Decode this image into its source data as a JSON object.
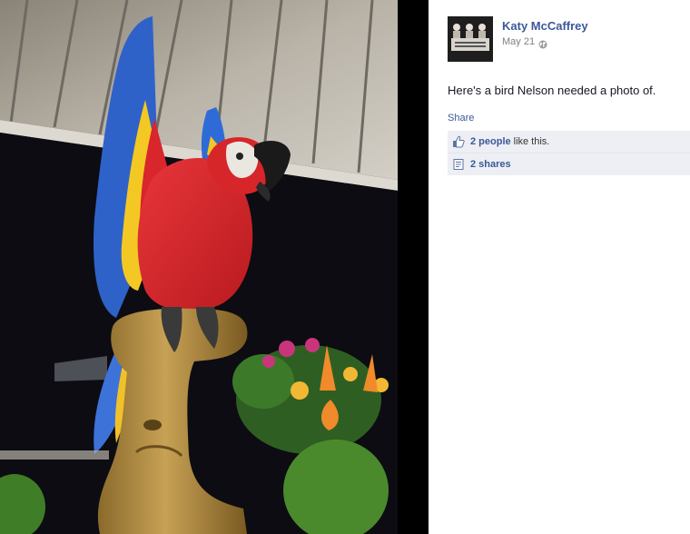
{
  "post": {
    "author_name": "Katy McCaffrey",
    "date": "May 21",
    "text": "Here's a bird Nelson needed a photo of.",
    "share_label": "Share"
  },
  "ufi": {
    "likes_link": "2 people",
    "likes_suffix": "like this.",
    "shares_link": "2 shares"
  },
  "icons": {
    "privacy": "globe-icon",
    "like": "thumbs-up-icon",
    "shares": "share-icon"
  },
  "colors": {
    "link": "#3b5998",
    "ufi_background": "#edeff4",
    "photo_background": "#000000"
  }
}
